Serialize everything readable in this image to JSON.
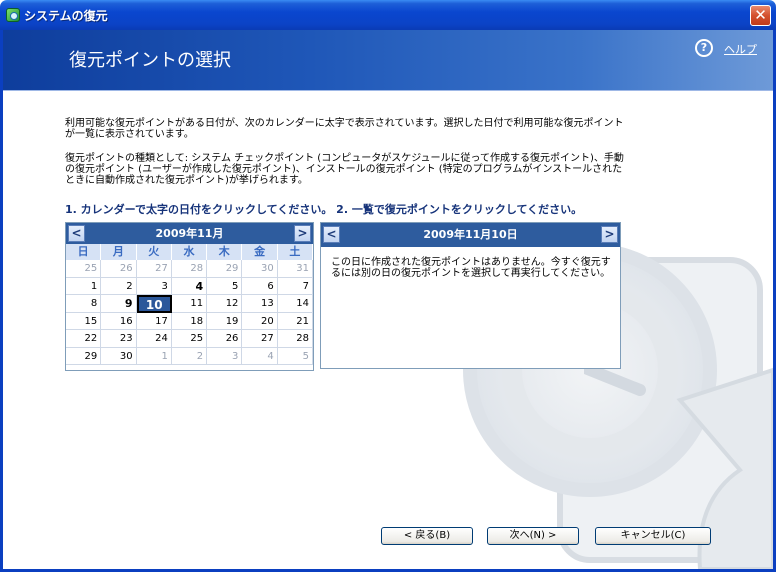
{
  "window": {
    "title": "システムの復元"
  },
  "header": {
    "title": "復元ポイントの選択",
    "help_label": "ヘルプ"
  },
  "description": {
    "para1": "利用可能な復元ポイントがある日付が、次のカレンダーに太字で表示されています。選択した日付で利用可能な復元ポイントが一覧に表示されています。",
    "para2": "復元ポイントの種類として: システム チェックポイント (コンピュータがスケジュールに従って作成する復元ポイント)、手動の復元ポイント (ユーザーが作成した復元ポイント)、インストールの復元ポイント (特定のプログラムがインストールされたときに自動作成された復元ポイント)が挙げられます。"
  },
  "instructions": "1. カレンダーで太字の日付をクリックしてください。 2. 一覧で復元ポイントをクリックしてください。",
  "calendar": {
    "month_label": "2009年11月",
    "prev_label": "<",
    "next_label": ">",
    "weekdays": [
      "日",
      "月",
      "火",
      "水",
      "木",
      "金",
      "土"
    ],
    "days": [
      {
        "d": "25",
        "other": true
      },
      {
        "d": "26",
        "other": true
      },
      {
        "d": "27",
        "other": true
      },
      {
        "d": "28",
        "other": true
      },
      {
        "d": "29",
        "other": true
      },
      {
        "d": "30",
        "other": true
      },
      {
        "d": "31",
        "other": true
      },
      {
        "d": "1"
      },
      {
        "d": "2"
      },
      {
        "d": "3"
      },
      {
        "d": "4",
        "bold": true
      },
      {
        "d": "5"
      },
      {
        "d": "6"
      },
      {
        "d": "7"
      },
      {
        "d": "8"
      },
      {
        "d": "9",
        "bold": true
      },
      {
        "d": "10",
        "selected": true
      },
      {
        "d": "11"
      },
      {
        "d": "12"
      },
      {
        "d": "13"
      },
      {
        "d": "14"
      },
      {
        "d": "15"
      },
      {
        "d": "16"
      },
      {
        "d": "17"
      },
      {
        "d": "18"
      },
      {
        "d": "19"
      },
      {
        "d": "20"
      },
      {
        "d": "21"
      },
      {
        "d": "22"
      },
      {
        "d": "23"
      },
      {
        "d": "24"
      },
      {
        "d": "25"
      },
      {
        "d": "26"
      },
      {
        "d": "27"
      },
      {
        "d": "28"
      },
      {
        "d": "29"
      },
      {
        "d": "30"
      },
      {
        "d": "1",
        "other": true
      },
      {
        "d": "2",
        "other": true
      },
      {
        "d": "3",
        "other": true
      },
      {
        "d": "4",
        "other": true
      },
      {
        "d": "5",
        "other": true
      }
    ]
  },
  "restore_points": {
    "date_label": "2009年11月10日",
    "prev_label": "<",
    "next_label": ">",
    "message": "この日に作成された復元ポイントはありません。今すぐ復元するには別の日の復元ポイントを選択して再実行してください。"
  },
  "buttons": {
    "back": "< 戻る(B)",
    "next": "次へ(N) >",
    "cancel": "キャンセル(C)"
  },
  "colors": {
    "header_dark": "#0e3d9c",
    "calendar_head": "#2e5c9e",
    "instruction_text": "#16337a",
    "titlebar": "#0a46cf"
  }
}
